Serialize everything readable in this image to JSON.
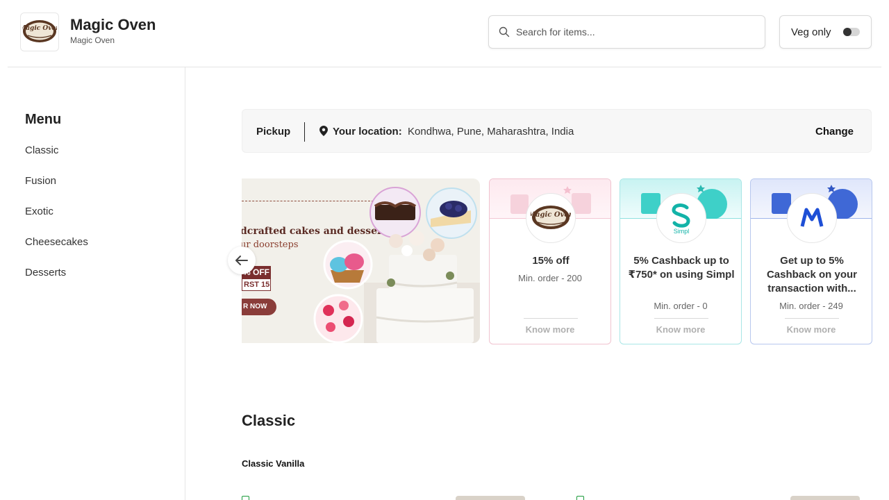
{
  "header": {
    "brand_title": "Magic Oven",
    "brand_subtitle": "Magic Oven",
    "logo_text": "Magic Oven",
    "search_placeholder": "Search for items...",
    "veg_only_label": "Veg only",
    "veg_only_enabled": false
  },
  "sidebar": {
    "title": "Menu",
    "items": [
      {
        "label": "Classic"
      },
      {
        "label": "Fusion"
      },
      {
        "label": "Exotic"
      },
      {
        "label": "Cheesecakes"
      },
      {
        "label": "Desserts"
      }
    ]
  },
  "location": {
    "mode": "Pickup",
    "label": "Your location:",
    "value": "Kondhwa, Pune, Maharashtra, India",
    "change_label": "Change"
  },
  "banner": {
    "line1": "dcrafted cakes and desserts",
    "line2": "ur doorsteps",
    "offer": "% OFF",
    "code": "RST 15",
    "cta": "R NOW"
  },
  "offers": [
    {
      "title": "15% off",
      "min_order": "Min. order - 200",
      "know_more": "Know more",
      "accent": "#f3c6d3"
    },
    {
      "title": "5% Cashback up to ₹750* on using Simpl",
      "min_order": "Min. order - 0",
      "know_more": "Know more",
      "accent": "#7fe0e0",
      "logo_text": "Simpl"
    },
    {
      "title": "Get up to 5% Cashback on your transaction with...",
      "min_order": "Min. order - 249",
      "know_more": "Know more",
      "accent": "#8aa6e8"
    }
  ],
  "section": {
    "title": "Classic",
    "first_item": "Classic Vanilla"
  },
  "colors": {
    "veg_green": "#1a9a3a",
    "brand_brown": "#7a2e2e"
  }
}
